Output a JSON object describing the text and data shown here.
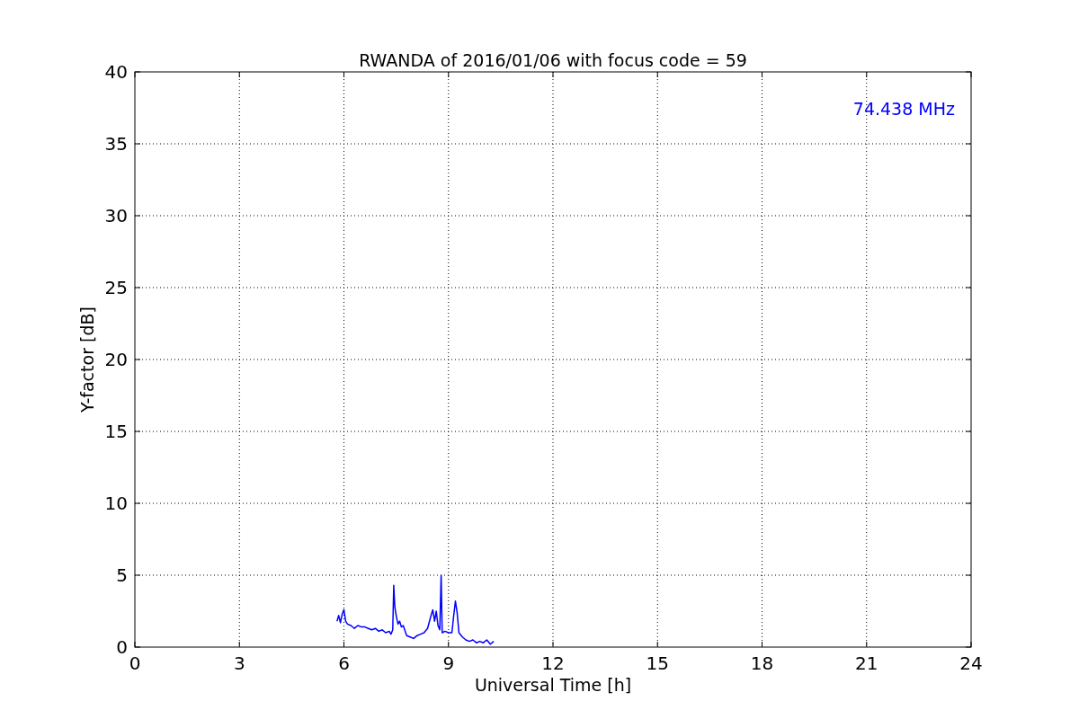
{
  "chart_data": {
    "type": "line",
    "title": "RWANDA of 2016/01/06 with focus code = 59",
    "xlabel": "Universal Time [h]",
    "ylabel": "Y-factor [dB]",
    "x": [
      5.8,
      5.85,
      5.9,
      5.95,
      6.0,
      6.05,
      6.1,
      6.2,
      6.3,
      6.4,
      6.5,
      6.6,
      6.7,
      6.8,
      6.9,
      7.0,
      7.1,
      7.2,
      7.3,
      7.35,
      7.4,
      7.43,
      7.46,
      7.5,
      7.55,
      7.6,
      7.65,
      7.7,
      7.8,
      7.9,
      8.0,
      8.1,
      8.2,
      8.3,
      8.4,
      8.5,
      8.55,
      8.6,
      8.65,
      8.7,
      8.75,
      8.79,
      8.82,
      8.9,
      9.0,
      9.1,
      9.15,
      9.2,
      9.25,
      9.3,
      9.4,
      9.5,
      9.6,
      9.7,
      9.8,
      9.9,
      10.0,
      10.1,
      10.2,
      10.3
    ],
    "series": [
      {
        "name": "74.438 MHz",
        "color": "#0000ff",
        "values": [
          1.8,
          2.2,
          1.7,
          2.3,
          2.6,
          1.8,
          1.6,
          1.5,
          1.3,
          1.5,
          1.4,
          1.4,
          1.3,
          1.2,
          1.3,
          1.1,
          1.2,
          1.0,
          1.1,
          0.9,
          1.2,
          4.3,
          2.8,
          2.2,
          1.6,
          1.8,
          1.4,
          1.5,
          0.8,
          0.7,
          0.6,
          0.8,
          0.9,
          1.0,
          1.3,
          2.2,
          2.6,
          1.8,
          2.5,
          1.5,
          1.2,
          5.0,
          1.0,
          1.1,
          1.0,
          1.0,
          2.2,
          3.2,
          2.4,
          1.0,
          0.7,
          0.5,
          0.4,
          0.5,
          0.3,
          0.4,
          0.3,
          0.5,
          0.2,
          0.4
        ]
      }
    ],
    "grid": true,
    "xlim": [
      0,
      24
    ],
    "ylim": [
      0,
      40
    ],
    "xticks": [
      0,
      3,
      6,
      9,
      12,
      15,
      18,
      21,
      24
    ],
    "yticks": [
      0,
      5,
      10,
      15,
      20,
      25,
      30,
      35,
      40
    ]
  }
}
